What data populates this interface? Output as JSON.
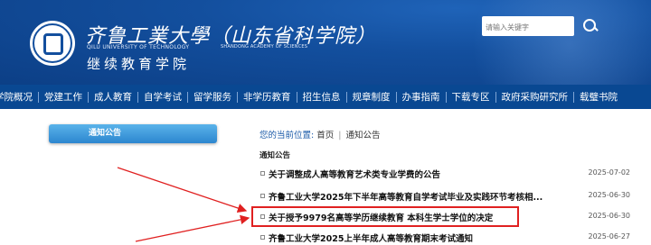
{
  "header": {
    "school_name": "齐鲁工業大學（山东省科学院）",
    "school_name_en": "QILU UNIVERSITY OF TECHNOLOGY",
    "academy_en": "SHANDONG ACADEMY OF SCIENCES",
    "college_name": "继续教育学院",
    "search_placeholder": "请输入关键字"
  },
  "nav": {
    "items": [
      "学院概况",
      "党建工作",
      "成人教育",
      "自学考试",
      "留学服务",
      "非学历教育",
      "招生信息",
      "规章制度",
      "办事指南",
      "下载专区",
      "政府采购研究所",
      "载璧书院"
    ]
  },
  "sidebar": {
    "button_label": "通知公告"
  },
  "breadcrumb": {
    "label": "您的当前位置:",
    "home": "首页",
    "sep": "|",
    "current": "通知公告"
  },
  "section_title": "通知公告",
  "news": [
    {
      "title": "关于调整成人高等教育艺术类专业学费的公告",
      "date": "2025-07-02"
    },
    {
      "title": "齐鲁工业大学2025年下半年高等教育自学考试毕业及实践环节考核相...",
      "date": "2025-06-30"
    },
    {
      "title": "关于授予9979名高等学历继续教育 本科生学士学位的决定",
      "date": "2025-06-30"
    },
    {
      "title": "齐鲁工业大学2025上半年成人高等教育期末考试通知",
      "date": "2025-06-27"
    }
  ],
  "colors": {
    "header": "#134f9e",
    "nav": "#094892",
    "highlight": "#e02020",
    "button": "#3a96dc"
  }
}
